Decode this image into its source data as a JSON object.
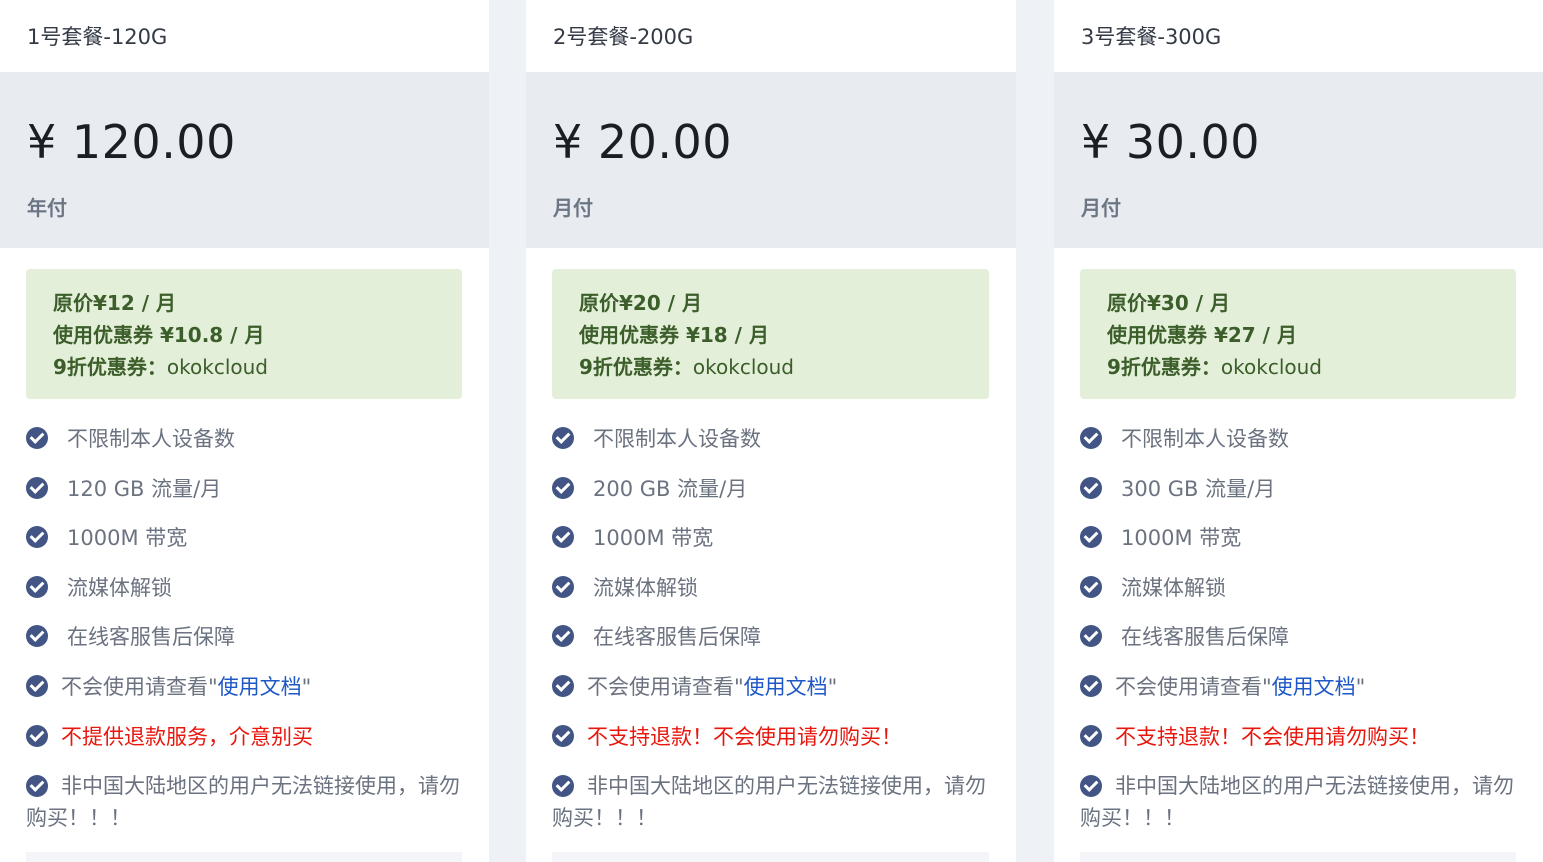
{
  "plans": [
    {
      "name": "1号套餐-120G",
      "price": "¥ 120.00",
      "billing": "年付",
      "promo": {
        "original": "原价¥12 / 月",
        "with_coupon": "使用优惠券 ¥10.8 / 月",
        "coupon_label": "9折优惠券：",
        "coupon_code": "okokcloud"
      },
      "features": {
        "devices": "不限制本人设备数",
        "traffic": "120 GB 流量/月",
        "bandwidth": "1000M 带宽",
        "streaming": "流媒体解锁",
        "support": "在线客服售后保障",
        "docs_prefix": "不会使用请查看\"",
        "docs_link": "使用文档",
        "docs_suffix": "\"",
        "refund": "不提供退款服务，介意别买",
        "region": "非中国大陆地区的用户无法链接使用，请勿购买！！！"
      }
    },
    {
      "name": "2号套餐-200G",
      "price": "¥ 20.00",
      "billing": "月付",
      "promo": {
        "original": "原价¥20 / 月",
        "with_coupon": "使用优惠券 ¥18 / 月",
        "coupon_label": "9折优惠券：",
        "coupon_code": "okokcloud"
      },
      "features": {
        "devices": "不限制本人设备数",
        "traffic": "200 GB 流量/月",
        "bandwidth": "1000M 带宽",
        "streaming": "流媒体解锁",
        "support": "在线客服售后保障",
        "docs_prefix": "不会使用请查看\"",
        "docs_link": "使用文档",
        "docs_suffix": "\"",
        "refund": "不支持退款！不会使用请勿购买！",
        "region": "非中国大陆地区的用户无法链接使用，请勿购买！！！"
      }
    },
    {
      "name": "3号套餐-300G",
      "price": "¥ 30.00",
      "billing": "月付",
      "promo": {
        "original": "原价¥30 / 月",
        "with_coupon": "使用优惠券 ¥27 / 月",
        "coupon_label": "9折优惠券：",
        "coupon_code": "okokcloud"
      },
      "features": {
        "devices": "不限制本人设备数",
        "traffic": "300 GB 流量/月",
        "bandwidth": "1000M 带宽",
        "streaming": "流媒体解锁",
        "support": "在线客服售后保障",
        "docs_prefix": "不会使用请查看\"",
        "docs_link": "使用文档",
        "docs_suffix": "\"",
        "refund": "不支持退款！不会使用请勿购买！",
        "region": "非中国大陆地区的用户无法链接使用，请勿购买！！！"
      }
    }
  ],
  "icons": {
    "check": "check-circle-icon"
  },
  "colors": {
    "check_icon": "#425585",
    "promo_bg": "#e4efd9",
    "promo_text": "#3b5e2a",
    "warning_text": "#e8170d",
    "link": "#1e58c5",
    "price_bg": "#e8ebef"
  }
}
